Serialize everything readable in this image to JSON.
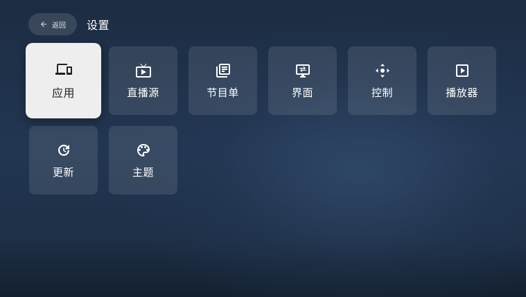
{
  "header": {
    "back_label": "返回",
    "title": "设置"
  },
  "tiles": [
    {
      "label": "应用",
      "icon": "devices-icon",
      "focused": true
    },
    {
      "label": "直播源",
      "icon": "live-tv-icon"
    },
    {
      "label": "节目单",
      "icon": "library-books-icon"
    },
    {
      "label": "界面",
      "icon": "interface-icon"
    },
    {
      "label": "控制",
      "icon": "control-dpad-icon"
    },
    {
      "label": "播放器",
      "icon": "play-box-icon"
    },
    {
      "label": "更新",
      "icon": "update-icon"
    },
    {
      "label": "主题",
      "icon": "palette-icon"
    }
  ],
  "colors": {
    "focused_tile": "#eeeeee",
    "tile": "#ffffff1a",
    "background": "#1e3150"
  }
}
